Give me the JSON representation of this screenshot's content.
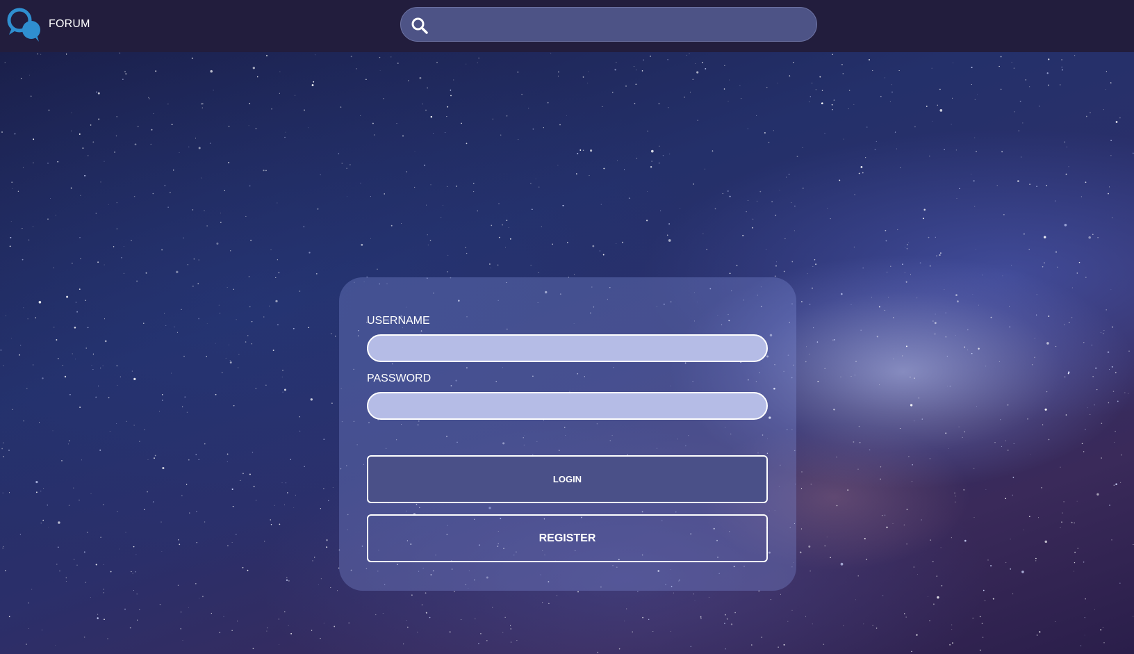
{
  "header": {
    "brand": "FORUM",
    "logo_icon": "chat-bubbles-icon",
    "search": {
      "icon": "search-icon",
      "placeholder": "",
      "value": ""
    }
  },
  "login_form": {
    "username_label": "USERNAME",
    "username_value": "",
    "password_label": "PASSWORD",
    "password_value": "",
    "login_button": "LOGIN",
    "register_button": "REGISTER"
  },
  "colors": {
    "navbar": "#221d3d",
    "search_bg": "#4d5386",
    "logo_accent": "#2f8fd0",
    "field_bg": "#b5bce6",
    "login_button_bg": "#4a5088",
    "text": "#ffffff"
  }
}
